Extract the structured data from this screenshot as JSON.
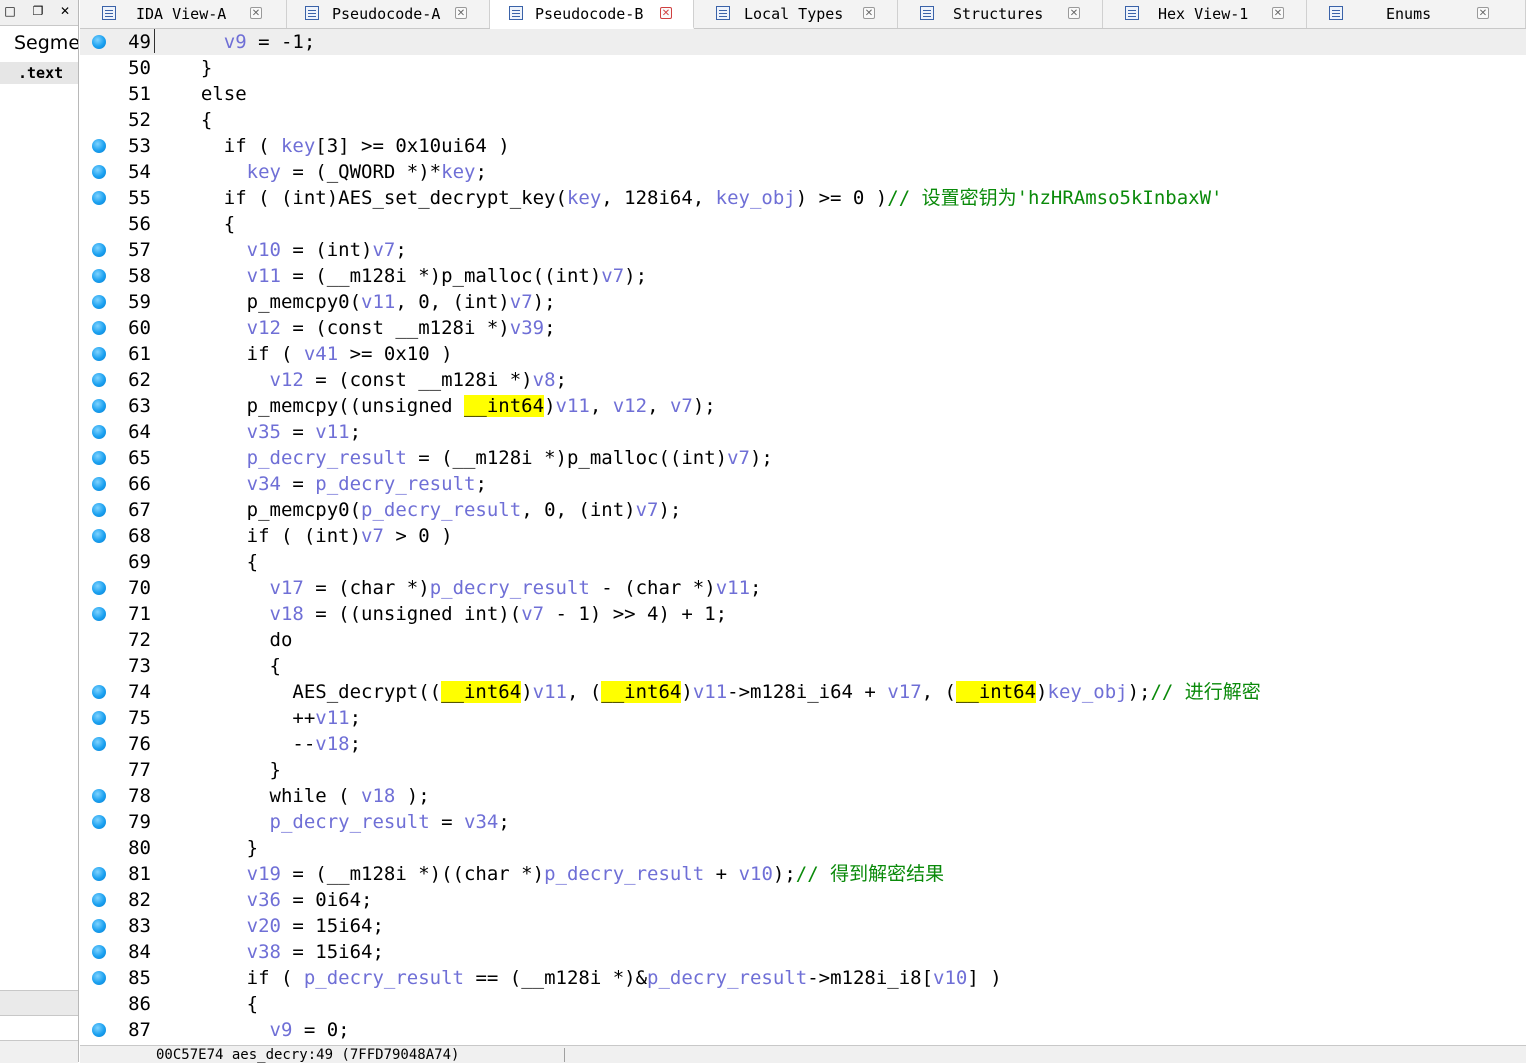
{
  "left_panel": {
    "titlebar_icons": [
      "restore-icon",
      "pin-icon",
      "close-icon"
    ],
    "header": "Segme",
    "row_label": ".text"
  },
  "tabs": [
    {
      "label": "IDA View-A",
      "active": false
    },
    {
      "label": "Pseudocode-A",
      "active": false
    },
    {
      "label": "Pseudocode-B",
      "active": true
    },
    {
      "label": "Local Types",
      "active": false
    },
    {
      "label": "Structures",
      "active": false
    },
    {
      "label": "Hex View-1",
      "active": false
    },
    {
      "label": "Enums",
      "active": false
    }
  ],
  "colors": {
    "variable": "#6f6fd6",
    "comment": "#0a8a0a",
    "highlight": "#ffff00",
    "breakpoint": "#1aa0f0",
    "current_line": "#eeeeee"
  },
  "code_lines": [
    {
      "n": "49",
      "bp": true,
      "src": "    ⟦v9⟧ = -1;"
    },
    {
      "n": "50",
      "bp": false,
      "src": "  }"
    },
    {
      "n": "51",
      "bp": false,
      "src": "  else"
    },
    {
      "n": "52",
      "bp": false,
      "src": "  {"
    },
    {
      "n": "53",
      "bp": true,
      "src": "    if ( ⟦key⟧[3] >= 0x10ui64 )"
    },
    {
      "n": "54",
      "bp": true,
      "src": "      ⟦key⟧ = (_QWORD *)*⟦key⟧;"
    },
    {
      "n": "55",
      "bp": true,
      "src": "    if ( (int)AES_set_decrypt_key(⟦key⟧, 128i64, ⟦key_obj⟧) >= 0 )⟪// 设置密钥为'hzHRAmso5kInbaxW'⟫"
    },
    {
      "n": "56",
      "bp": false,
      "src": "    {"
    },
    {
      "n": "57",
      "bp": true,
      "src": "      ⟦v10⟧ = (int)⟦v7⟧;"
    },
    {
      "n": "58",
      "bp": true,
      "src": "      ⟦v11⟧ = (__m128i *)p_malloc((int)⟦v7⟧);"
    },
    {
      "n": "59",
      "bp": true,
      "src": "      p_memcpy0(⟦v11⟧, 0, (int)⟦v7⟧);"
    },
    {
      "n": "60",
      "bp": true,
      "src": "      ⟦v12⟧ = (const __m128i *)⟦v39⟧;"
    },
    {
      "n": "61",
      "bp": true,
      "src": "      if ( ⟦v41⟧ >= 0x10 )"
    },
    {
      "n": "62",
      "bp": true,
      "src": "        ⟦v12⟧ = (const __m128i *)⟦v8⟧;"
    },
    {
      "n": "63",
      "bp": true,
      "src": "      p_memcpy((unsigned «__int64»)⟦v11⟧, ⟦v12⟧, ⟦v7⟧);"
    },
    {
      "n": "64",
      "bp": true,
      "src": "      ⟦v35⟧ = ⟦v11⟧;"
    },
    {
      "n": "65",
      "bp": true,
      "src": "      ⟦p_decry_result⟧ = (__m128i *)p_malloc((int)⟦v7⟧);"
    },
    {
      "n": "66",
      "bp": true,
      "src": "      ⟦v34⟧ = ⟦p_decry_result⟧;"
    },
    {
      "n": "67",
      "bp": true,
      "src": "      p_memcpy0(⟦p_decry_result⟧, 0, (int)⟦v7⟧);"
    },
    {
      "n": "68",
      "bp": true,
      "src": "      if ( (int)⟦v7⟧ > 0 )"
    },
    {
      "n": "69",
      "bp": false,
      "src": "      {"
    },
    {
      "n": "70",
      "bp": true,
      "src": "        ⟦v17⟧ = (char *)⟦p_decry_result⟧ - (char *)⟦v11⟧;"
    },
    {
      "n": "71",
      "bp": true,
      "src": "        ⟦v18⟧ = ((unsigned int)(⟦v7⟧ - 1) >> 4) + 1;"
    },
    {
      "n": "72",
      "bp": false,
      "src": "        do"
    },
    {
      "n": "73",
      "bp": false,
      "src": "        {"
    },
    {
      "n": "74",
      "bp": true,
      "src": "          AES_decrypt((«__int64»)⟦v11⟧, («__int64»)⟦v11⟧->m128i_i64 + ⟦v17⟧, («__int64»)⟦key_obj⟧);⟪// 进行解密⟫"
    },
    {
      "n": "75",
      "bp": true,
      "src": "          ++⟦v11⟧;"
    },
    {
      "n": "76",
      "bp": true,
      "src": "          --⟦v18⟧;"
    },
    {
      "n": "77",
      "bp": false,
      "src": "        }"
    },
    {
      "n": "78",
      "bp": true,
      "src": "        while ( ⟦v18⟧ );"
    },
    {
      "n": "79",
      "bp": true,
      "src": "        ⟦p_decry_result⟧ = ⟦v34⟧;"
    },
    {
      "n": "80",
      "bp": false,
      "src": "      }"
    },
    {
      "n": "81",
      "bp": true,
      "src": "      ⟦v19⟧ = (__m128i *)((char *)⟦p_decry_result⟧ + ⟦v10⟧);⟪// 得到解密结果⟫"
    },
    {
      "n": "82",
      "bp": true,
      "src": "      ⟦v36⟧ = 0i64;"
    },
    {
      "n": "83",
      "bp": true,
      "src": "      ⟦v20⟧ = 15i64;"
    },
    {
      "n": "84",
      "bp": true,
      "src": "      ⟦v38⟧ = 15i64;"
    },
    {
      "n": "85",
      "bp": true,
      "src": "      if ( ⟦p_decry_result⟧ == (__m128i *)&⟦p_decry_result⟧->m128i_i8[⟦v10⟧] )"
    },
    {
      "n": "86",
      "bp": false,
      "src": "      {"
    },
    {
      "n": "87",
      "bp": true,
      "src": "        ⟦v9⟧ = 0;"
    }
  ],
  "status": {
    "text": "00C57E74 aes_decry:49 (7FFD79048A74)"
  }
}
